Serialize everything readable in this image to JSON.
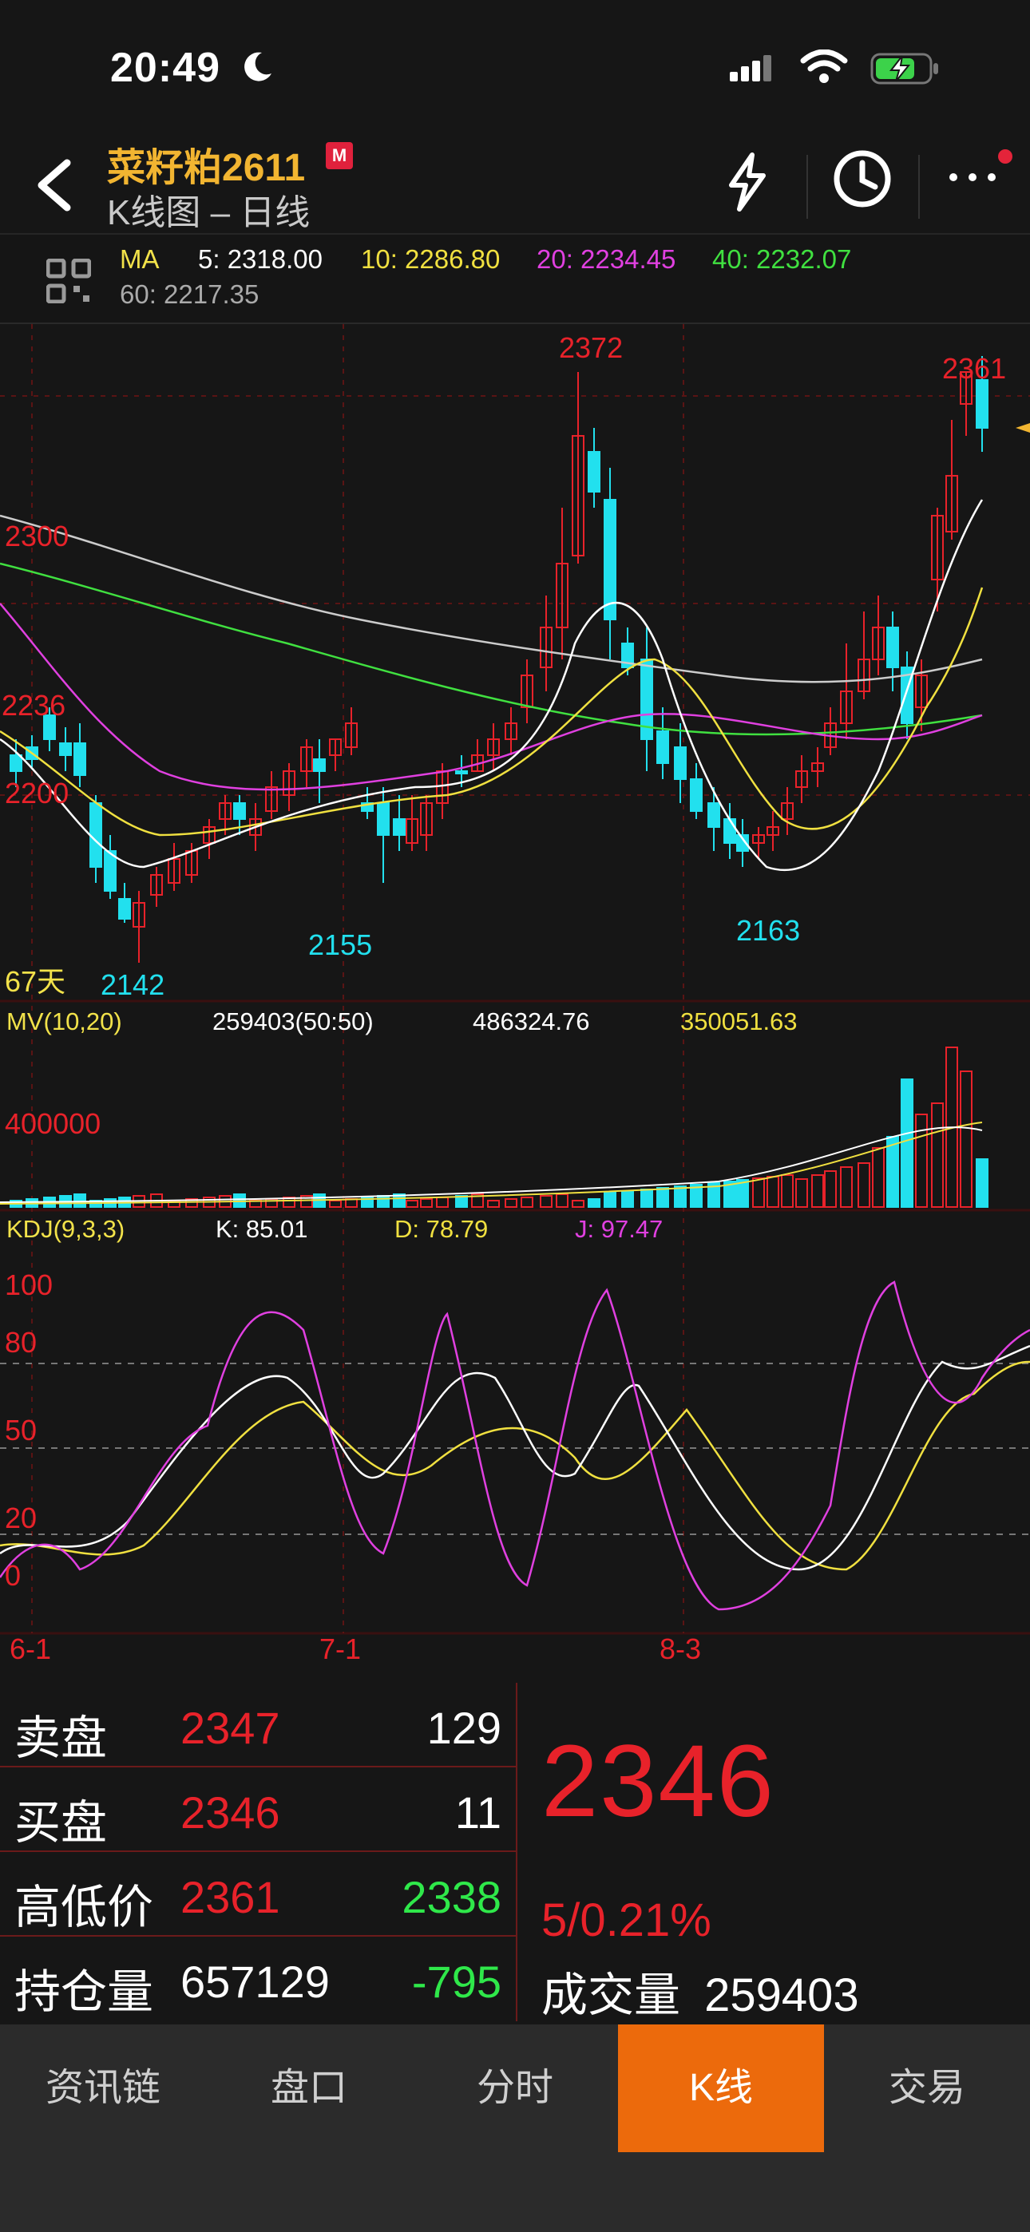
{
  "status": {
    "time": "20:49"
  },
  "header": {
    "symbol": "菜籽粕2611",
    "badge": "M",
    "subtitle": "K线图 – 日线"
  },
  "ma": {
    "label": "MA",
    "ma5": "5: 2318.00",
    "ma10": "10: 2286.80",
    "ma20": "20: 2234.45",
    "ma40": "40: 2232.07",
    "ma60": "60: 2217.35"
  },
  "kline": {
    "price_labels": [
      "2300",
      "2236",
      "2200"
    ],
    "high_label": "2372",
    "last_high_label": "2361",
    "low_labels": [
      "2142",
      "2155",
      "2163"
    ],
    "days_label": "67天"
  },
  "volume": {
    "title": "MV(10,20)",
    "vol": "259403(50:50)",
    "mv10": "486324.76",
    "mv20": "350051.63",
    "axis_label": "400000"
  },
  "kdj": {
    "title": "KDJ(9,3,3)",
    "k": "K: 85.01",
    "d": "D: 78.79",
    "j": "J: 97.47",
    "axis_labels": [
      "100",
      "80",
      "50",
      "20",
      "0"
    ]
  },
  "dates": [
    "6-1",
    "7-1",
    "8-3"
  ],
  "quote": {
    "sell_label": "卖盘",
    "sell_price": "2347",
    "sell_qty": "129",
    "buy_label": "买盘",
    "buy_price": "2346",
    "buy_qty": "11",
    "hl_label": "高低价",
    "high": "2361",
    "low": "2338",
    "oi_label": "持仓量",
    "oi": "657129",
    "oi_change": "-795",
    "last": "2346",
    "change": "5/0.21%",
    "vol_label": "成交量",
    "volume": "259403"
  },
  "tabs": [
    "资讯链",
    "盘口",
    "分时",
    "K线",
    "交易"
  ],
  "colors": {
    "up": "#e8222a",
    "down": "#22e0ee",
    "gold": "#f2b531",
    "ma5": "#ffffff",
    "ma10": "#f0e040",
    "ma20": "#e040e0",
    "ma40": "#40e040",
    "ma60": "#cccccc",
    "tab_active": "#ec6a0c"
  }
}
